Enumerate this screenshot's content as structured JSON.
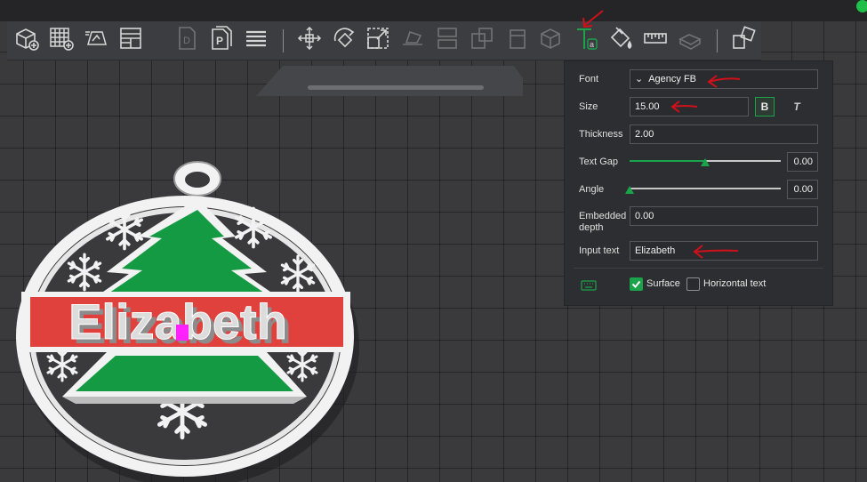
{
  "app": {
    "accent": "#1aa34a",
    "status_color": "#1fbf4a"
  },
  "toolbar": {
    "items": [
      {
        "icon": "add-cube-icon",
        "enabled": true
      },
      {
        "icon": "add-grid-icon",
        "enabled": true
      },
      {
        "icon": "auto-arrange-icon",
        "enabled": true
      },
      {
        "icon": "plate-layout-icon",
        "enabled": true
      },
      {
        "icon": "model-file-icon",
        "enabled": false
      },
      {
        "icon": "project-file-icon",
        "enabled": true
      },
      {
        "icon": "list-menu-icon",
        "enabled": true
      },
      {
        "icon": "move-icon",
        "enabled": true
      },
      {
        "icon": "rotate-icon",
        "enabled": true
      },
      {
        "icon": "scale-icon",
        "enabled": true
      },
      {
        "icon": "lay-on-face-icon",
        "enabled": false
      },
      {
        "icon": "split-icon",
        "enabled": false
      },
      {
        "icon": "cut-icon",
        "enabled": false
      },
      {
        "icon": "support-paint-icon",
        "enabled": false
      },
      {
        "icon": "seam-paint-icon",
        "enabled": false
      },
      {
        "icon": "text-tool-icon",
        "enabled": true
      },
      {
        "icon": "color-paint-icon",
        "enabled": true
      },
      {
        "icon": "measure-icon",
        "enabled": true
      },
      {
        "icon": "assembly-icon",
        "enabled": false
      },
      {
        "icon": "assembly-view-icon",
        "enabled": true
      }
    ]
  },
  "text_panel": {
    "font_label": "Font",
    "font_value": "Agency FB",
    "size_label": "Size",
    "size_value": "15.00",
    "bold_label": "B",
    "italic_label": "T",
    "thickness_label": "Thickness",
    "thickness_value": "2.00",
    "text_gap_label": "Text Gap",
    "text_gap_value": "0.00",
    "text_gap_fraction": 0.5,
    "angle_label": "Angle",
    "angle_value": "0.00",
    "angle_fraction": 0.0,
    "embedded_label_1": "Embedded",
    "embedded_label_2": "depth",
    "embedded_value": "0.00",
    "input_text_label": "Input text",
    "input_text_value": "Elizabeth",
    "surface_label": "Surface",
    "surface_checked": true,
    "horizontal_label": "Horizontal text",
    "horizontal_checked": false
  },
  "model": {
    "text": "Elizabeth",
    "colors": {
      "frame": "#f2f2f2",
      "tree": "#159a44",
      "band": "#e0413c",
      "text": "#d9d9d9"
    }
  }
}
